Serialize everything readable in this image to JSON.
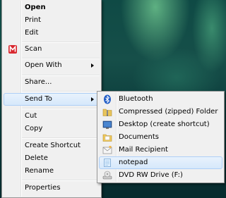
{
  "main_menu": [
    {
      "label": "Open",
      "bold": true
    },
    {
      "label": "Print"
    },
    {
      "label": "Edit"
    },
    {
      "label": "Scan",
      "icon": "scan-app-icon"
    },
    {
      "label": "Open With",
      "submenu": true
    },
    {
      "label": "Share..."
    },
    {
      "label": "Send To",
      "submenu": true,
      "highlighted": true
    },
    {
      "label": "Cut"
    },
    {
      "label": "Copy"
    },
    {
      "label": "Create Shortcut"
    },
    {
      "label": "Delete"
    },
    {
      "label": "Rename"
    },
    {
      "label": "Properties"
    }
  ],
  "send_to_menu": [
    {
      "label": "Bluetooth",
      "icon": "bluetooth-icon"
    },
    {
      "label": "Compressed (zipped) Folder",
      "icon": "zip-folder-icon"
    },
    {
      "label": "Desktop (create shortcut)",
      "icon": "desktop-icon"
    },
    {
      "label": "Documents",
      "icon": "documents-folder-icon"
    },
    {
      "label": "Mail Recipient",
      "icon": "mail-icon"
    },
    {
      "label": "notepad",
      "icon": "notepad-icon",
      "highlighted": true
    },
    {
      "label": "DVD RW Drive (F:)",
      "icon": "dvd-drive-icon"
    }
  ],
  "colors": {
    "highlight": "#d6e8fb",
    "highlight_border": "#aecff7",
    "menu_bg": "#f0f0f0"
  }
}
